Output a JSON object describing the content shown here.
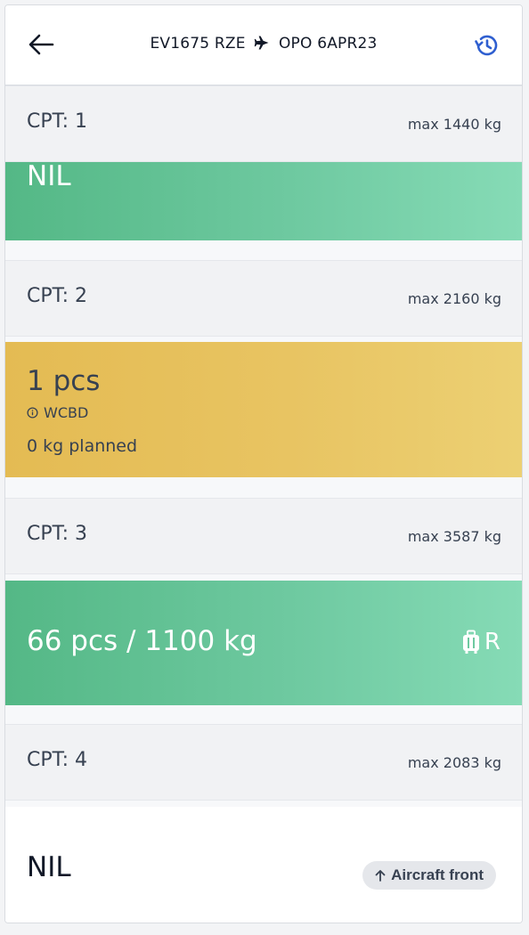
{
  "header": {
    "flight_number": "EV1675",
    "origin": "RZE",
    "destination": "OPO",
    "date": "6APR23"
  },
  "compartments": [
    {
      "name": "CPT: 1",
      "max": "max 1440 kg",
      "content": {
        "main": "NIL",
        "status": "green"
      }
    },
    {
      "name": "CPT: 2",
      "max": "max 2160 kg",
      "content": {
        "main": "1 pcs",
        "info": "WCBD",
        "planned": "0 kg planned",
        "status": "yellow"
      }
    },
    {
      "name": "CPT: 3",
      "max": "max 3587 kg",
      "content": {
        "main": "66 pcs / 1100 kg",
        "tag": "R",
        "tag_icon": "luggage-icon",
        "status": "green"
      }
    },
    {
      "name": "CPT: 4",
      "max": "max 2083 kg",
      "content": {
        "main": "NIL",
        "status": "white"
      }
    }
  ],
  "badge": {
    "label": "Aircraft front",
    "icon": "arrow-up-icon"
  },
  "colors": {
    "green_start": "#54b886",
    "green_end": "#86dbb6",
    "yellow_start": "#e4bb53",
    "yellow_end": "#ecd073",
    "accent_blue": "#2f5fd0"
  }
}
